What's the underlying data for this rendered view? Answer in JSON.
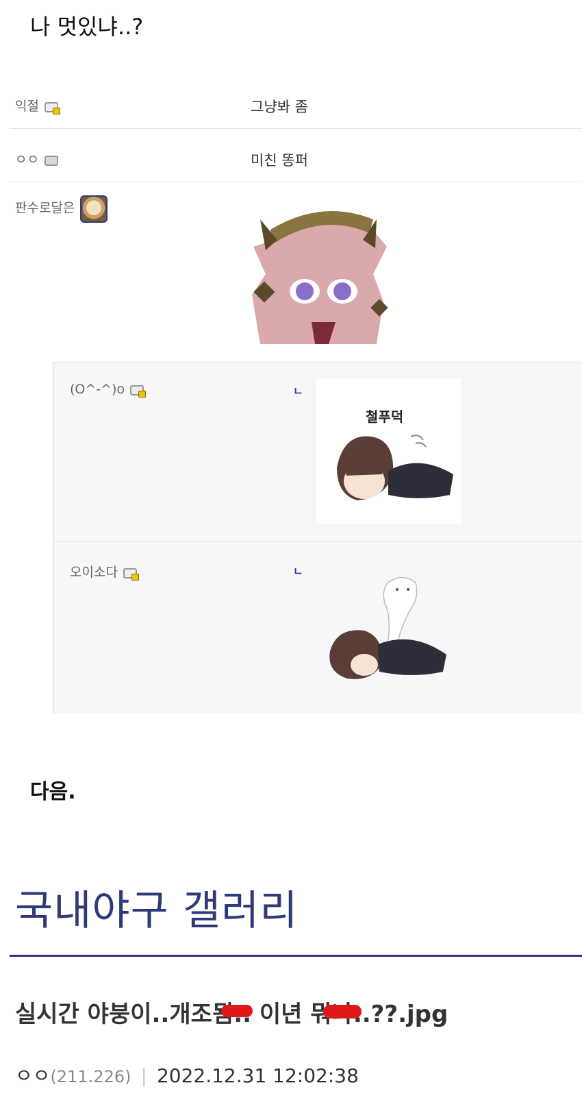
{
  "top_caption": "나 멋있냐..?",
  "comments": [
    {
      "nick": "익절",
      "text": "그냥봐 좀"
    },
    {
      "nick": "ㅇㅇ",
      "text": "미친 똥퍼"
    },
    {
      "nick": "판수로달은",
      "text": ""
    }
  ],
  "replies": [
    {
      "nick": "(O^-^)o",
      "mark": "ㄴ",
      "sticker_text": "철푸덕"
    },
    {
      "nick": "오이소다",
      "mark": "ㄴ"
    }
  ],
  "section_title": "다음.",
  "gallery": {
    "title": "국내야구 갤러리",
    "post_title": "실시간 야붕이..개조됨.. 이년 뭐냐..??.jpg",
    "author": "ㅇㅇ",
    "ip": "(211.226)",
    "separator": "|",
    "datetime": "2022.12.31 12:02:38"
  },
  "colors": {
    "gallery_blue": "#2e3a78",
    "reply_mark": "#2a3b9a",
    "redact_red": "#e01818"
  }
}
